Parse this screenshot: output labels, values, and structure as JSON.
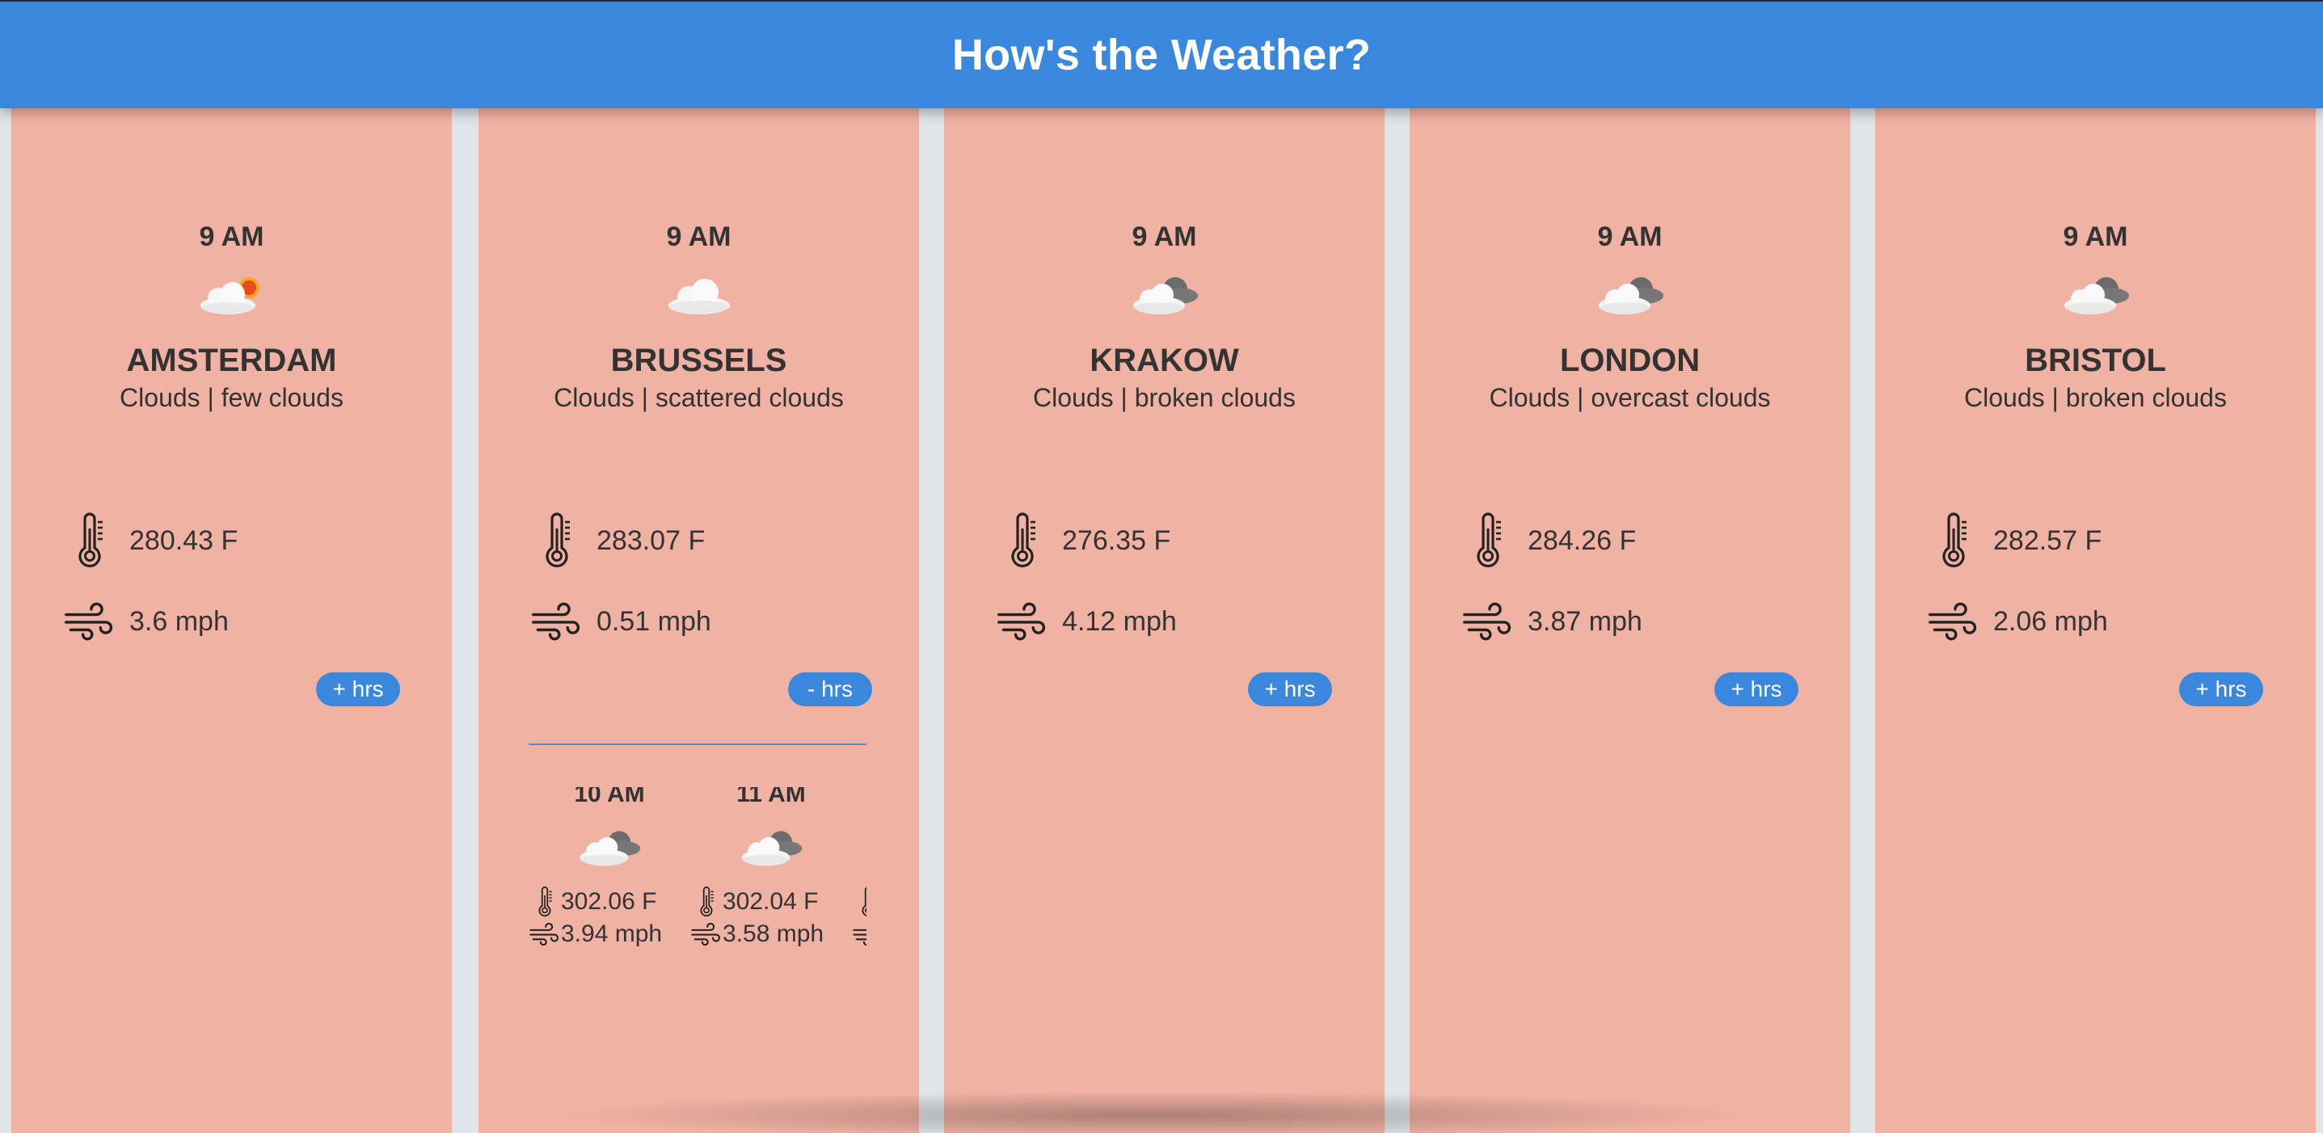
{
  "app": {
    "title": "How's the Weather?"
  },
  "colors": {
    "header": "#3a88de",
    "card": "#f0b2a3",
    "gap": "#dfe5e8",
    "text": "#333333",
    "button": "#3a88de"
  },
  "cards": [
    {
      "time": "9 AM",
      "icon": "partly-sunny-cloud-icon",
      "city": "AMSTERDAM",
      "description": "Clouds | few clouds",
      "temperature": "280.43 F",
      "wind": "3.6 mph",
      "toggle_label": "+ hrs"
    },
    {
      "time": "9 AM",
      "icon": "cloud-icon",
      "city": "BRUSSELS",
      "description": "Clouds | scattered clouds",
      "temperature": "283.07 F",
      "wind": "0.51 mph",
      "toggle_label": "- hrs",
      "hourly": [
        {
          "time": "10 AM",
          "icon": "broken-clouds-icon",
          "temperature": "302.06 F",
          "wind": "3.94 mph"
        },
        {
          "time": "11 AM",
          "icon": "broken-clouds-icon",
          "temperature": "302.04 F",
          "wind": "3.58 mph"
        }
      ]
    },
    {
      "time": "9 AM",
      "icon": "broken-clouds-icon",
      "city": "KRAKOW",
      "description": "Clouds | broken clouds",
      "temperature": "276.35 F",
      "wind": "4.12 mph",
      "toggle_label": "+ hrs"
    },
    {
      "time": "9 AM",
      "icon": "broken-clouds-icon",
      "city": "LONDON",
      "description": "Clouds | overcast clouds",
      "temperature": "284.26 F",
      "wind": "3.87 mph",
      "toggle_label": "+ hrs"
    },
    {
      "time": "9 AM",
      "icon": "broken-clouds-icon",
      "city": "BRISTOL",
      "description": "Clouds | broken clouds",
      "temperature": "282.57 F",
      "wind": "2.06 mph",
      "toggle_label": "+ hrs"
    }
  ]
}
